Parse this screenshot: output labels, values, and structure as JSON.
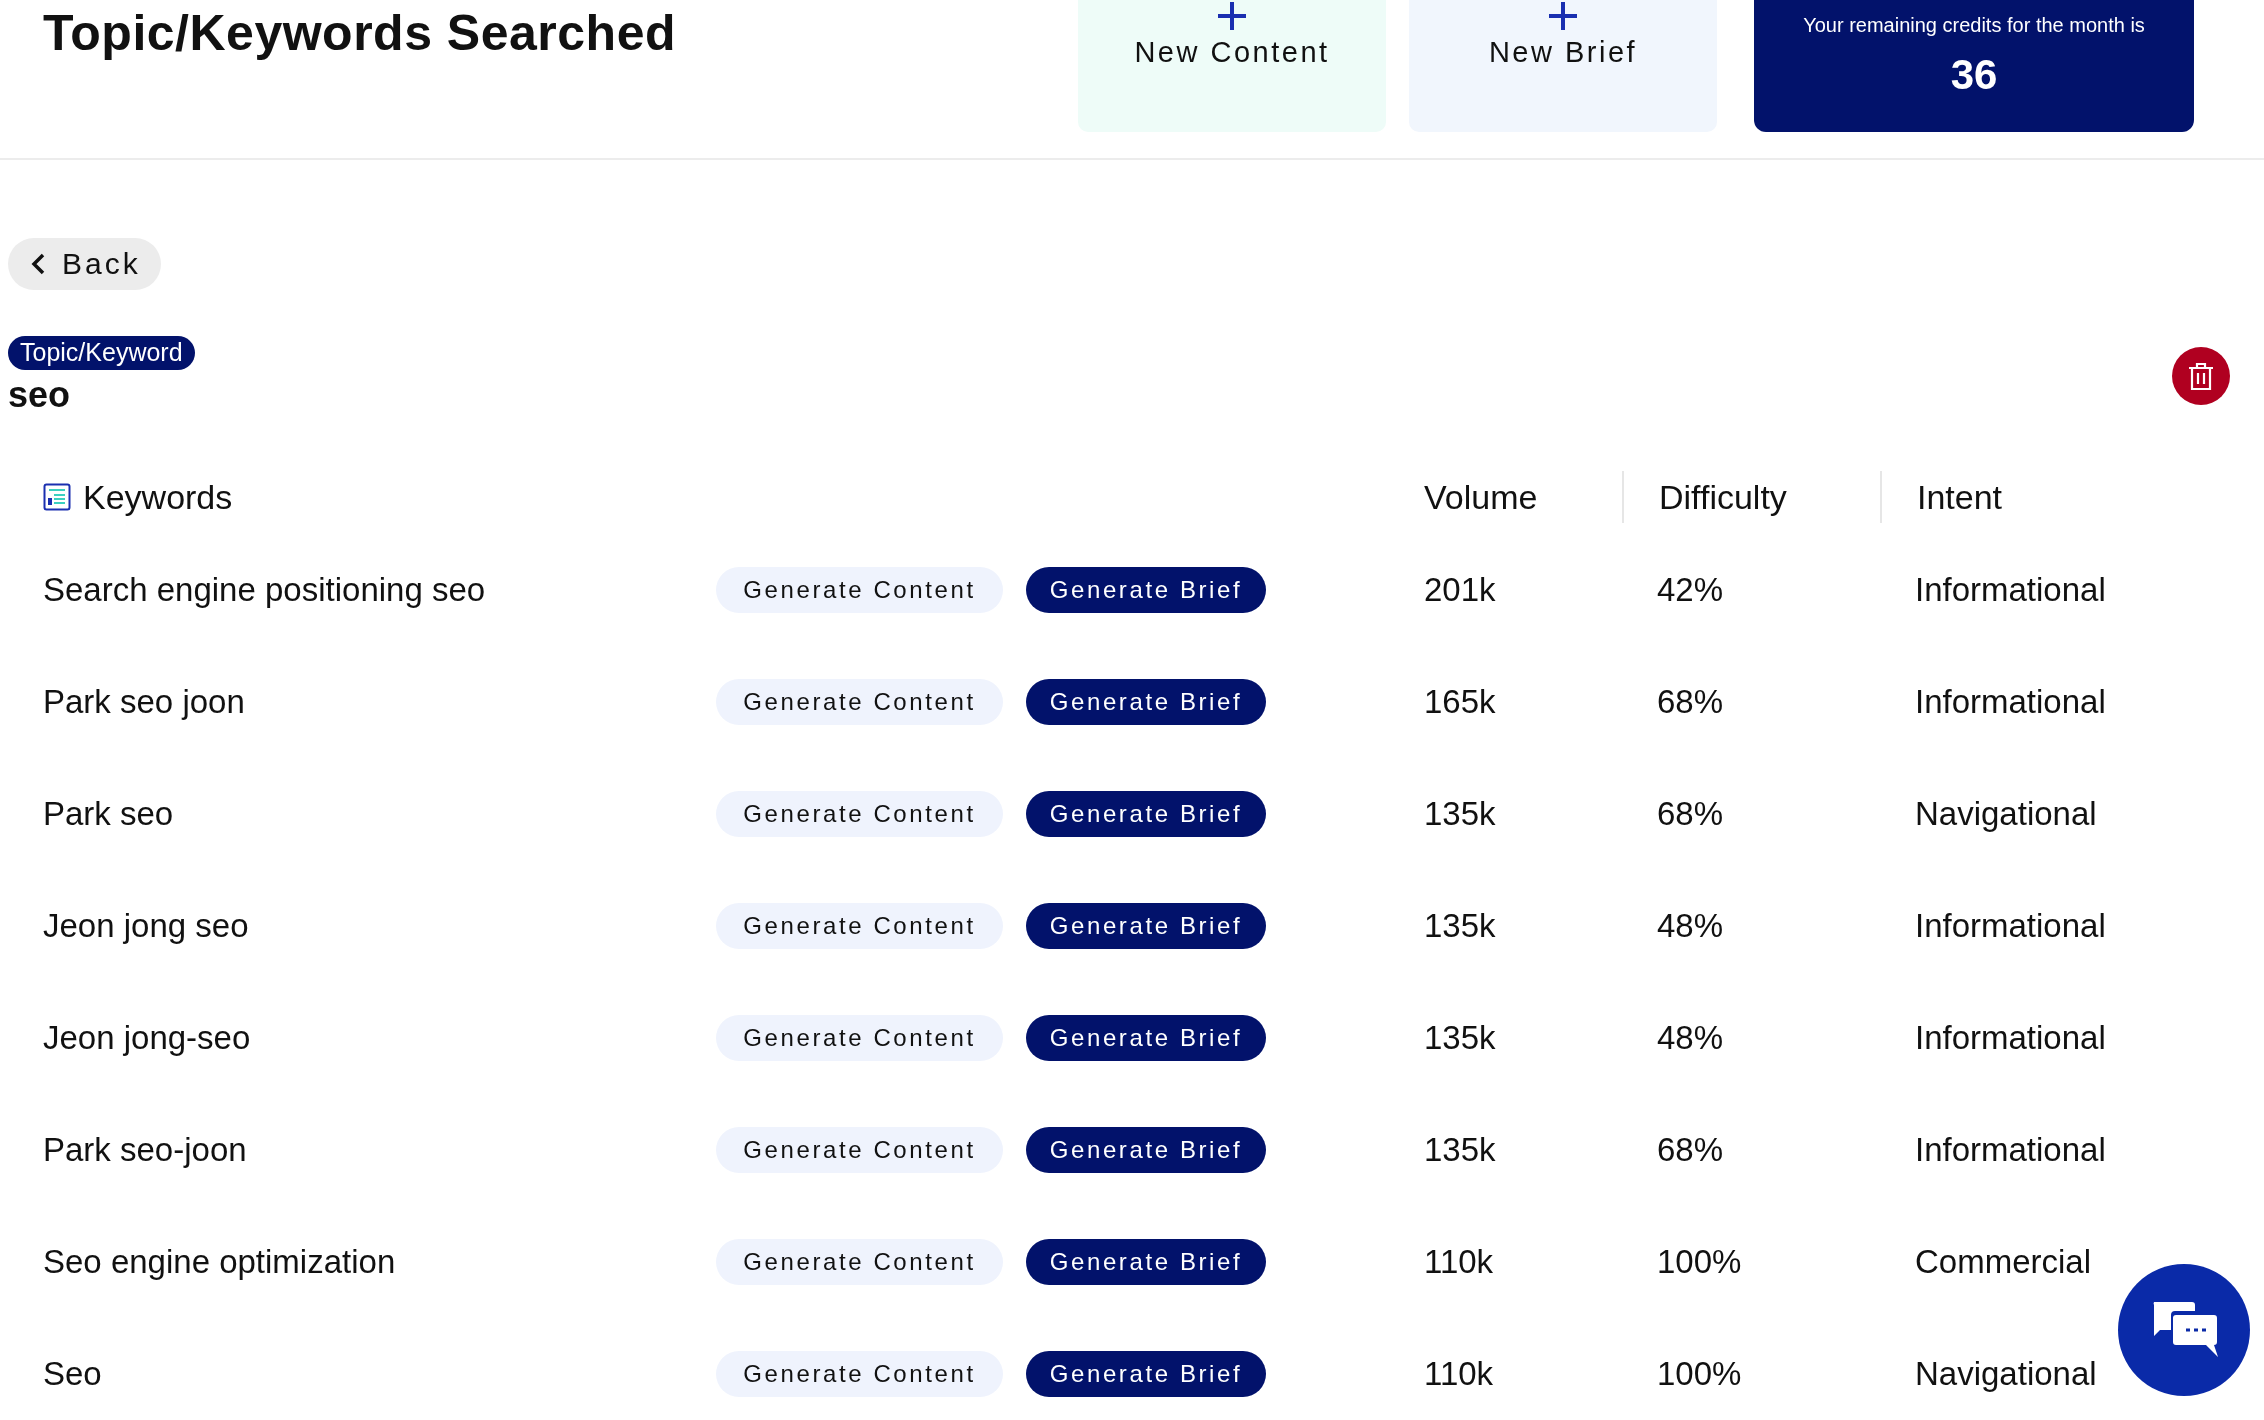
{
  "header": {
    "title": "Topic/Keywords Searched",
    "actions": [
      {
        "label": "New Content",
        "kind": "content"
      },
      {
        "label": "New Brief",
        "kind": "brief"
      }
    ],
    "credits": {
      "label": "Your remaining credits for the month is",
      "value": "36"
    }
  },
  "back_button": "Back",
  "topic": {
    "tag": "Topic/Keyword",
    "value": "seo"
  },
  "table": {
    "columns": [
      "Keywords",
      "Volume",
      "Difficulty",
      "Intent"
    ],
    "rows": [
      {
        "keyword": "Search engine positioning seo",
        "content_button": "Generate Content",
        "brief_button": "Generate Brief",
        "volume": "201k",
        "difficulty": "42%",
        "intent": "Informational"
      },
      {
        "keyword": "Park seo joon",
        "content_button": "Generate Content",
        "brief_button": "Generate Brief",
        "volume": "165k",
        "difficulty": "68%",
        "intent": "Informational"
      },
      {
        "keyword": "Park seo",
        "content_button": "Generate Content",
        "brief_button": "Generate Brief",
        "volume": "135k",
        "difficulty": "68%",
        "intent": "Navigational"
      },
      {
        "keyword": "Jeon jong seo",
        "content_button": "Generate Content",
        "brief_button": "Generate Brief",
        "volume": "135k",
        "difficulty": "48%",
        "intent": "Informational"
      },
      {
        "keyword": "Jeon jong-seo",
        "content_button": "Generate Content",
        "brief_button": "Generate Brief",
        "volume": "135k",
        "difficulty": "48%",
        "intent": "Informational"
      },
      {
        "keyword": "Park seo-joon",
        "content_button": "Generate Content",
        "brief_button": "Generate Brief",
        "volume": "135k",
        "difficulty": "68%",
        "intent": "Informational"
      },
      {
        "keyword": "Seo engine optimization",
        "content_button": "Generate Content",
        "brief_button": "Generate Brief",
        "volume": "110k",
        "difficulty": "100%",
        "intent": "Commercial"
      },
      {
        "keyword": "Seo",
        "content_button": "Generate Content",
        "brief_button": "Generate Brief",
        "volume": "110k",
        "difficulty": "100%",
        "intent": "Navigational"
      }
    ]
  }
}
